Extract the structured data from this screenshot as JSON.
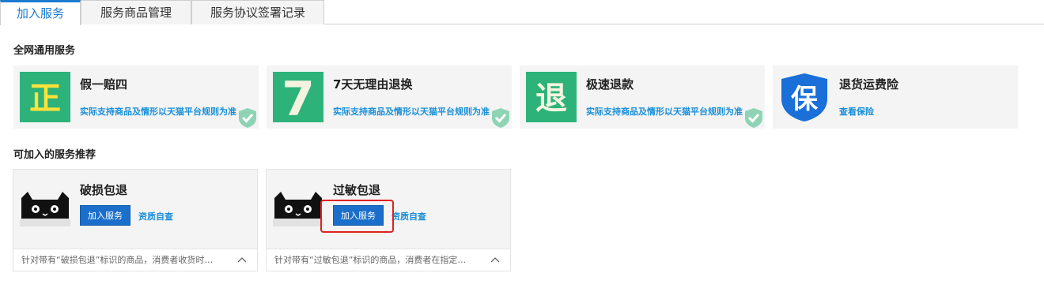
{
  "tabs": [
    {
      "label": "加入服务",
      "active": true
    },
    {
      "label": "服务商品管理",
      "active": false
    },
    {
      "label": "服务协议签署记录",
      "active": false
    }
  ],
  "section_general": {
    "title": "全网通用服务"
  },
  "services": [
    {
      "name": "假一赔四",
      "desc": "实际支持商品及情形以天猫平台规则为准",
      "logo_char": "正",
      "logo_color": "#2db37a",
      "icon": "genuine-icon",
      "joined": true
    },
    {
      "name": "7天无理由退换",
      "desc": "实际支持商品及情形以天猫平台规则为准",
      "logo_char": "7",
      "logo_color": "#2db37a",
      "icon": "seven-days-icon",
      "joined": true
    },
    {
      "name": "极速退款",
      "desc": "实际支持商品及情形以天猫平台规则为准",
      "logo_char": "退",
      "logo_color": "#2db37a",
      "icon": "refund-icon",
      "joined": true
    },
    {
      "name": "退货运费险",
      "desc": "查看保险",
      "logo_char": "保",
      "logo_color": "#1a6fd8",
      "icon": "insurance-shield-icon",
      "joined": false
    }
  ],
  "section_recommend": {
    "title": "可加入的服务推荐"
  },
  "recommend": [
    {
      "name": "破损包退",
      "join_label": "加入服务",
      "check_label": "资质自查",
      "footer": "针对带有“破损包退”标识的商品，消费者收货时…"
    },
    {
      "name": "过敏包退",
      "join_label": "加入服务",
      "check_label": "资质自查",
      "footer": "针对带有“过敏包退”标识的商品，消费者在指定…"
    }
  ],
  "colors": {
    "accent": "#1a7bd0",
    "link": "#1a8fd8",
    "green": "#2db37a",
    "button": "#1b6fca",
    "highlight": "#e02020"
  }
}
